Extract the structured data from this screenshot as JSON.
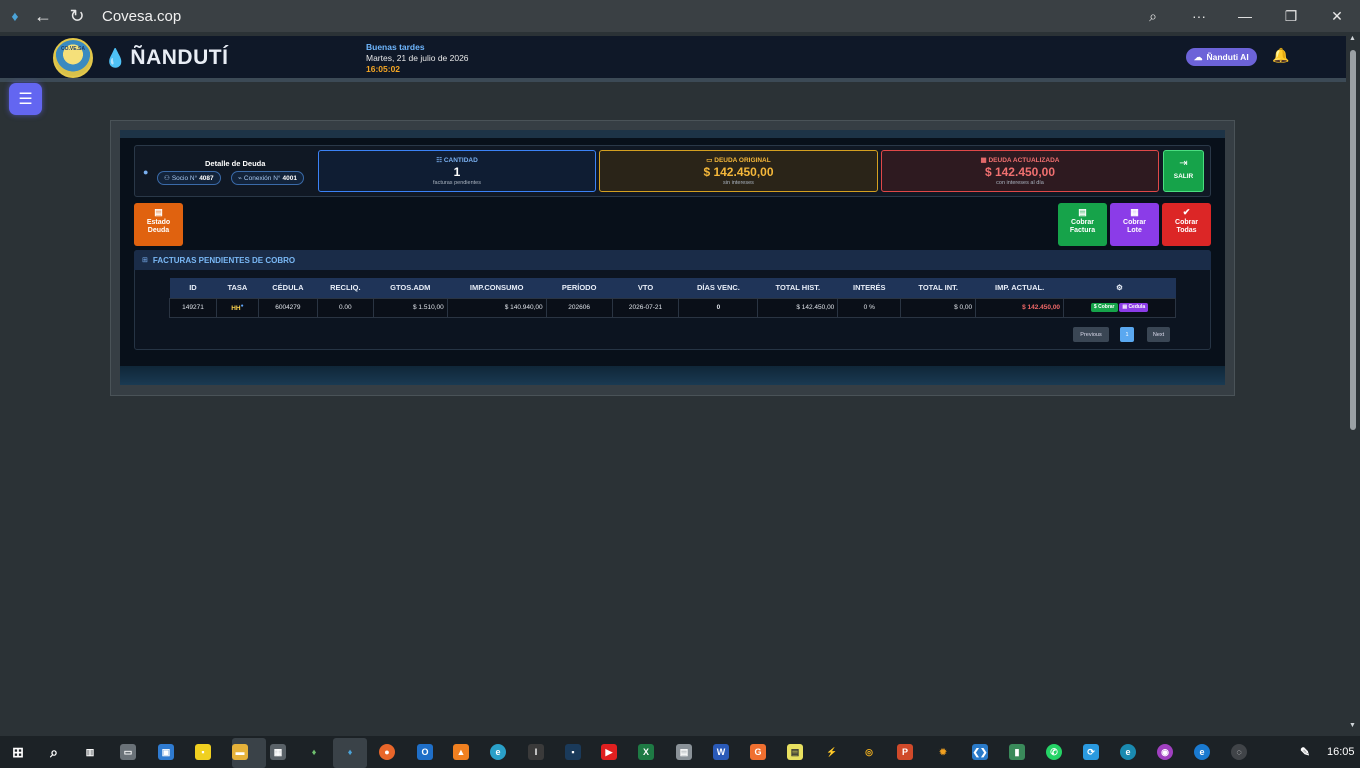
{
  "browser": {
    "site_title": "Covesa.cop"
  },
  "header": {
    "logo_text": "CO.VE.SA",
    "brand": "ÑANDUTÍ",
    "greeting": "Buenas tardes",
    "date": "Martes, 21 de julio de 2026",
    "time": "16:05:02",
    "ai_label": "Ñanduti AI"
  },
  "summary": {
    "title": "Detalle de Deuda",
    "socio_label": "Socio N°",
    "socio_value": "4087",
    "conexion_label": "Conexión N°",
    "conexion_value": "4001",
    "cantidad": {
      "label": "CANTIDAD",
      "value": "1",
      "sub": "facturas pendientes"
    },
    "deuda_original": {
      "label": "DEUDA ORIGINAL",
      "value": "$ 142.450,00",
      "sub": "sin intereses"
    },
    "deuda_actualizada": {
      "label": "DEUDA ACTUALIZADA",
      "value": "$ 142.450,00",
      "sub": "con intereses al día"
    },
    "exit_label": "SALIR"
  },
  "actions": {
    "estado_line1": "Estado",
    "estado_line2": "Deuda",
    "cobrar_factura_line1": "Cobrar",
    "cobrar_factura_line2": "Factura",
    "cobrar_lote_line1": "Cobrar",
    "cobrar_lote_line2": "Lote",
    "cobrar_todas_line1": "Cobrar",
    "cobrar_todas_line2": "Todas"
  },
  "section": {
    "title": "FACTURAS PENDIENTES DE COBRO"
  },
  "table": {
    "headers": [
      "ID",
      "TASA",
      "CÉDULA",
      "RECLIQ.",
      "GTOS.ADM",
      "IMP.CONSUMO",
      "PERÍODO",
      "VTO",
      "DÍAS VENC.",
      "TOTAL HIST.",
      "INTERÉS",
      "TOTAL INT.",
      "IMP. ACTUAL."
    ],
    "rows": [
      {
        "id": "149271",
        "tasa": "HH",
        "cedula": "6004279",
        "recliq": "0.00",
        "gtos_adm": "$ 1.510,00",
        "imp_consumo": "$ 140.940,00",
        "periodo": "202606",
        "vto": "2026-07-21",
        "dias_venc": "0",
        "total_hist": "$ 142.450,00",
        "interes": "0 %",
        "total_int": "$ 0,00",
        "imp_actual": "$ 142.450,00",
        "btn_cobrar": "Cobrar",
        "btn_cedula": "Cedula"
      }
    ]
  },
  "pager": {
    "previous": "Previous",
    "page": "1",
    "next": "Next"
  },
  "taskbar": {
    "clock": "16:05"
  },
  "colors": {
    "accent": "#6366f1",
    "success": "#16a34a",
    "warning": "#f5b83a",
    "danger": "#dc2626",
    "info": "#3b82f6"
  }
}
